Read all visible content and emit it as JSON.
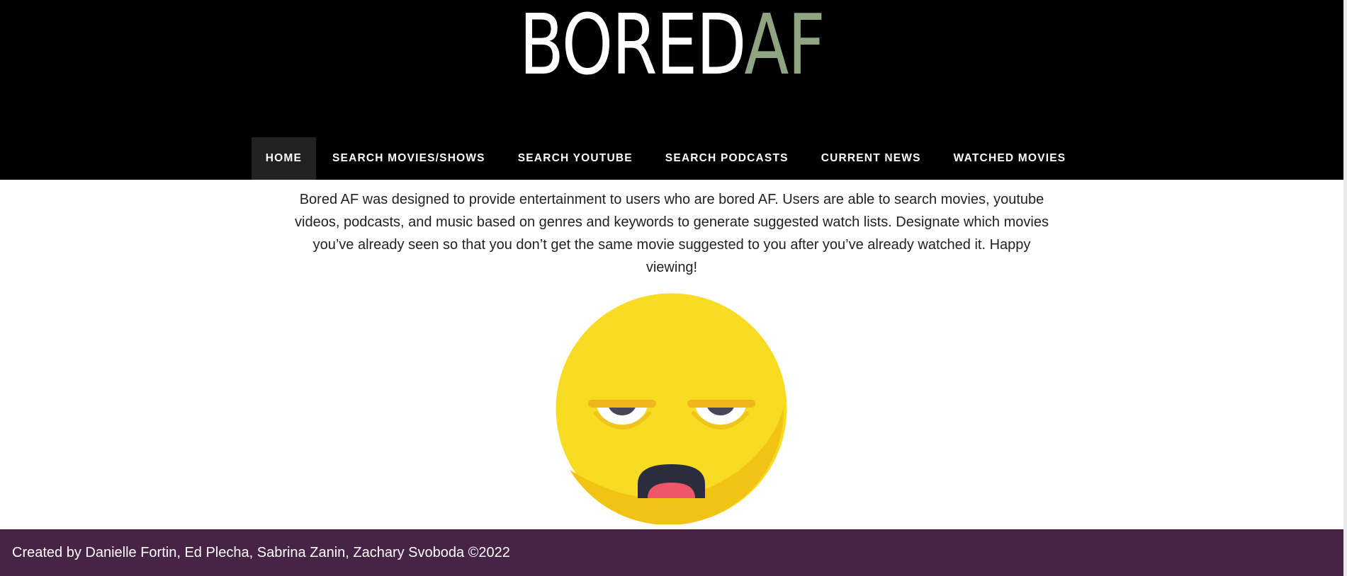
{
  "header": {
    "logo_main": "BORED",
    "logo_accent": "AF"
  },
  "nav": {
    "items": [
      {
        "label": "HOME",
        "active": true
      },
      {
        "label": "SEARCH MOVIES/SHOWS",
        "active": false
      },
      {
        "label": "SEARCH YOUTUBE",
        "active": false
      },
      {
        "label": "SEARCH PODCASTS",
        "active": false
      },
      {
        "label": "CURRENT NEWS",
        "active": false
      },
      {
        "label": "WATCHED MOVIES",
        "active": false
      }
    ]
  },
  "main": {
    "intro_text": "Bored AF was designed to provide entertainment to users who are bored AF. Users are able to search movies, youtube videos, podcasts, and music based on genres and keywords to generate suggested watch lists. Designate which movies you’ve already seen so that you don’t get the same movie suggested to you after you’ve already watched it. Happy viewing!",
    "image_icon": "bored-face-emoji"
  },
  "footer": {
    "credits": "Created by Danielle Fortin, Ed Plecha, Sabrina Zanin, Zachary Svoboda ©2022"
  },
  "colors": {
    "header_bg": "#000000",
    "logo_accent": "#8fa582",
    "nav_active_bg": "#222222",
    "footer_bg": "#472345",
    "emoji_face": "#f7dc21"
  }
}
